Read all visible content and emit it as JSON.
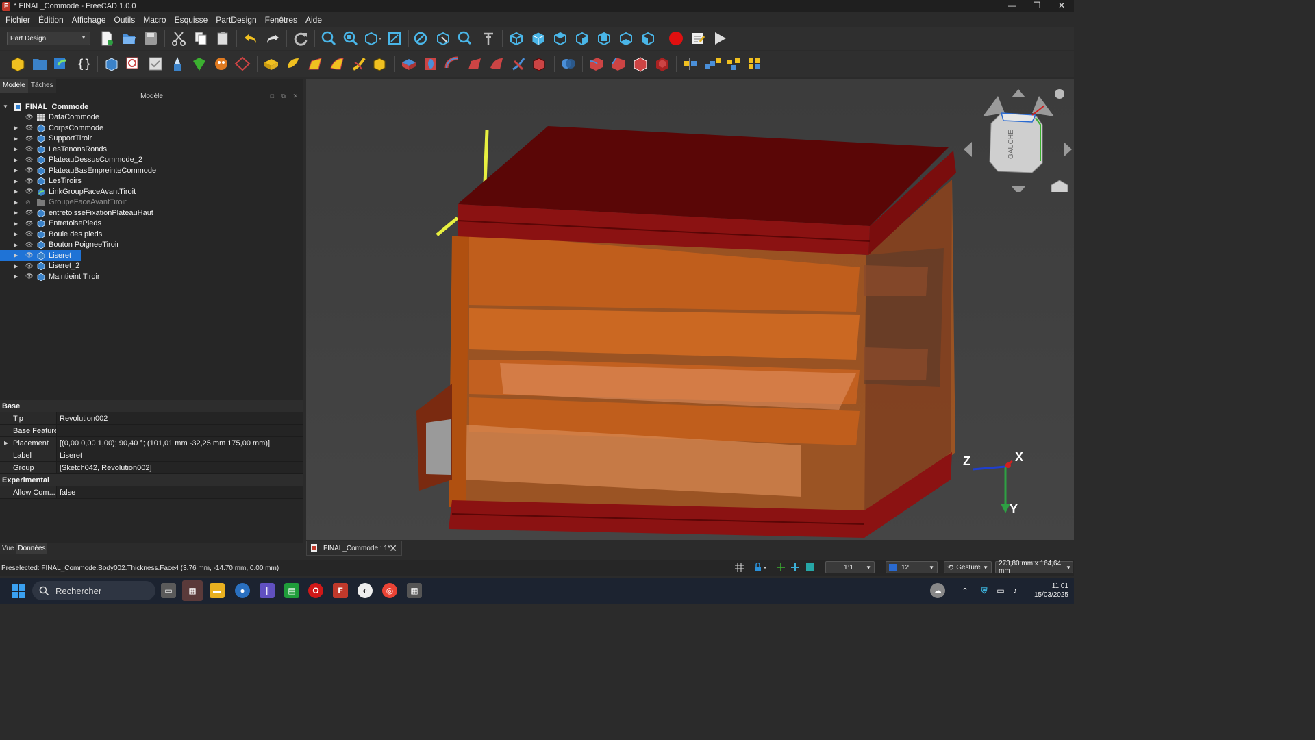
{
  "window": {
    "title": "* FINAL_Commode - FreeCAD 1.0.0",
    "minimize": "—",
    "restore": "❐",
    "close": "✕"
  },
  "menu": [
    "Fichier",
    "Édition",
    "Affichage",
    "Outils",
    "Macro",
    "Esquisse",
    "PartDesign",
    "Fenêtres",
    "Aide"
  ],
  "toolbar": {
    "workbench": "Part Design"
  },
  "combo_tabs": [
    "Modèle",
    "Tâches"
  ],
  "tree_header": "Modèle",
  "tree": {
    "root": "FINAL_Commode",
    "items": [
      {
        "label": "DataCommode",
        "icon": "spreadsheet-icon"
      },
      {
        "label": "CorpsCommode",
        "icon": "body-icon"
      },
      {
        "label": "SupportTiroir",
        "icon": "body-icon"
      },
      {
        "label": "LesTenonsRonds",
        "icon": "body-icon"
      },
      {
        "label": "PlateauDessusCommode_2",
        "icon": "body-icon"
      },
      {
        "label": "PlateauBasEmpreinteCommode",
        "icon": "body-icon"
      },
      {
        "label": "LesTiroirs",
        "icon": "body-icon"
      },
      {
        "label": "LinkGroupFaceAvantTiroit",
        "icon": "link-group-icon"
      },
      {
        "label": "GroupeFaceAvantTiroir",
        "icon": "folder-icon"
      },
      {
        "label": "entretoisseFixationPlateauHaut",
        "icon": "body-icon"
      },
      {
        "label": "EntretoisePieds",
        "icon": "body-icon"
      },
      {
        "label": "Boule des pieds",
        "icon": "body-icon"
      },
      {
        "label": "Bouton PoigneeTiroir",
        "icon": "body-icon"
      },
      {
        "label": "Liseret",
        "icon": "body-icon"
      },
      {
        "label": "Liseret_2",
        "icon": "body-icon"
      },
      {
        "label": "Maintieint Tiroir",
        "icon": "body-icon"
      }
    ]
  },
  "properties": {
    "group_base": "Base",
    "tip_key": "Tip",
    "tip_val": "Revolution002",
    "basefeature_key": "Base Feature",
    "basefeature_val": "",
    "placement_key": "Placement",
    "placement_val": "[(0,00 0,00 1,00); 90,40 °; (101,01 mm  -32,25 mm  175,00 mm)]",
    "label_key": "Label",
    "label_val": "Liseret",
    "group_key": "Group",
    "group_val": "[Sketch042, Revolution002]",
    "group_experimental": "Experimental",
    "allow_key": "Allow Com...",
    "allow_val": "false"
  },
  "bottom_tabs": [
    "Vue",
    "Données"
  ],
  "doc_tab": "FINAL_Commode : 1*",
  "navcube": {
    "face": "GAUCHE"
  },
  "axes": {
    "x": "X",
    "y": "Y",
    "z": "Z"
  },
  "status": {
    "preselected": "Preselected: FINAL_Commode.Body002.Thickness.Face4 (3.76 mm, -14.70 mm, 0.00 mm)",
    "zoom": "1:1",
    "layer": "12",
    "nav_style": "Gesture",
    "dimensions": "273,80 mm x 164,64 mm"
  },
  "taskbar": {
    "search": "Rechercher",
    "time": "11:01",
    "date": "15/03/2025"
  }
}
